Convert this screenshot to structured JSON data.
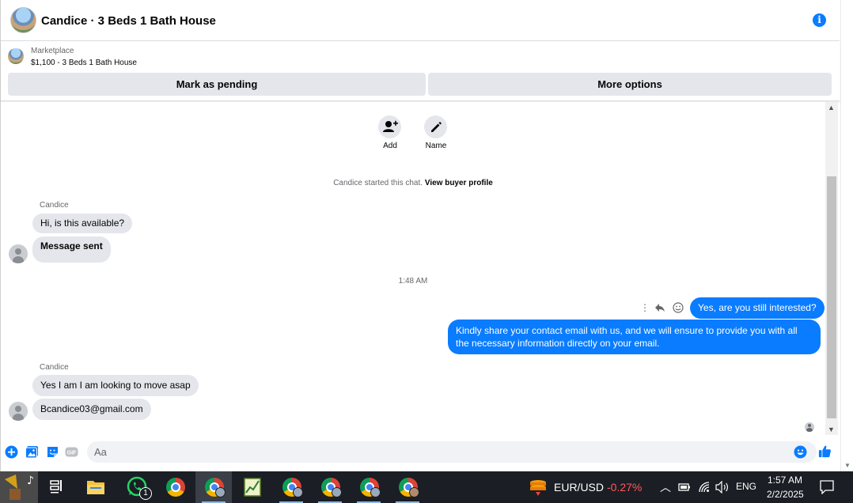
{
  "header": {
    "title": "Candice · 3 Beds 1 Bath House",
    "info_icon": "info-icon"
  },
  "listing": {
    "kicker": "Marketplace",
    "name": "$1,100 - 3 Beds 1 Bath House",
    "pending_label": "Mark as pending",
    "more_label": "More options"
  },
  "actions": [
    {
      "icon": "add-person-icon",
      "label": "Add"
    },
    {
      "icon": "pencil-icon",
      "label": "Name"
    }
  ],
  "chat": {
    "started_prefix": "Candice started this chat.",
    "started_link": "View buyer profile",
    "group1_sender": "Candice",
    "group1_messages": [
      "Hi, is this available?",
      "Message sent"
    ],
    "timestamp": "1:48 AM",
    "out_messages": [
      "Yes, are you still interested?",
      "Kindly share your contact email with us, and we will ensure to provide you with all the necessary information directly on your email."
    ],
    "group2_sender": "Candice",
    "group2_messages": [
      "Yes I am I am looking to move asap",
      "Bcandice03@gmail.com"
    ]
  },
  "composer": {
    "placeholder": "Aa"
  },
  "taskbar": {
    "whatsapp_badge": "1",
    "ticker_label": "EUR/USD",
    "ticker_change": "-0.27%",
    "language": "ENG",
    "time": "1:57 AM",
    "date": "2/2/2025"
  },
  "colors": {
    "accent": "#0a7cff",
    "bubble_in": "#e4e6eb",
    "taskbar": "#1b1e24",
    "negative": "#ff5a5a"
  }
}
